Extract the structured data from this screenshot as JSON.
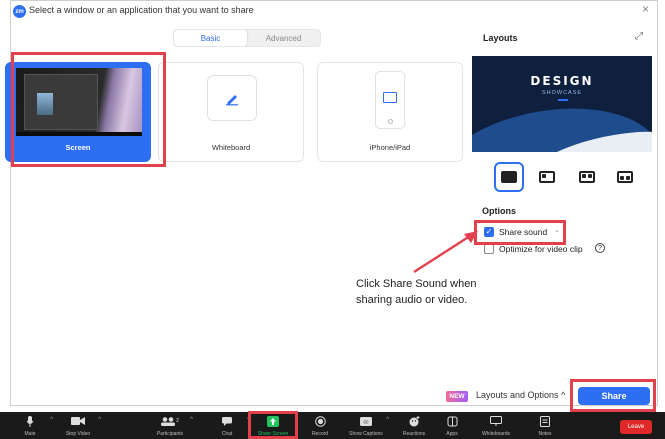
{
  "dialog": {
    "app_icon": "zoom-icon",
    "app_icon_text": "zm",
    "title": "Select a window or an application that you want to share",
    "close_glyph": "×"
  },
  "tabs": [
    {
      "label": "Basic",
      "active": true
    },
    {
      "label": "Advanced",
      "active": false
    }
  ],
  "share_tiles": [
    {
      "label": "Screen",
      "selected": true
    },
    {
      "label": "Whiteboard",
      "selected": false
    },
    {
      "label": "iPhone/iPad",
      "selected": false
    }
  ],
  "layouts": {
    "heading": "Layouts",
    "expand_glyph": "⤢",
    "preview": {
      "title": "DESIGN",
      "subtitle": "SHOWCASE"
    },
    "options": [
      "full-screen-icon",
      "picture-in-picture-icon",
      "side-by-side-icon",
      "speaker-overlay-icon"
    ],
    "selected_index": 0
  },
  "options": {
    "heading": "Options",
    "share_sound": {
      "label": "Share sound",
      "checked": true
    },
    "optimize_video": {
      "label": "Optimize for video clip",
      "checked": false
    },
    "help_glyph": "?"
  },
  "annotation": {
    "text": "Click Share Sound when sharing audio or video."
  },
  "footer": {
    "new_badge": "NEW",
    "layouts_options_label": "Layouts and Options",
    "layouts_options_chevron": "^",
    "share_button": "Share"
  },
  "toolbar": {
    "items": [
      {
        "label": "Mute",
        "icon": "microphone-icon",
        "caret": true
      },
      {
        "label": "Stop Video",
        "icon": "video-camera-icon",
        "caret": true
      },
      {
        "label": "Participants",
        "icon": "participants-icon",
        "badge": "2",
        "caret": true
      },
      {
        "label": "Chat",
        "icon": "chat-icon",
        "caret": true
      },
      {
        "label": "Share Screen",
        "icon": "share-screen-icon",
        "caret": false
      },
      {
        "label": "Record",
        "icon": "record-icon",
        "caret": false
      },
      {
        "label": "Show Captions",
        "icon": "captions-icon",
        "caret": true
      },
      {
        "label": "Reactions",
        "icon": "reactions-icon",
        "caret": false
      },
      {
        "label": "Apps",
        "icon": "apps-icon",
        "caret": false
      },
      {
        "label": "Whiteboards",
        "icon": "whiteboards-icon",
        "caret": false
      },
      {
        "label": "Notes",
        "icon": "notes-icon",
        "caret": false
      }
    ],
    "leave_label": "Leave"
  },
  "colors": {
    "accent": "#2d6ef2",
    "highlight": "#e3404e",
    "toolbar_bg": "#1a1a1a",
    "leave": "#e02828"
  }
}
